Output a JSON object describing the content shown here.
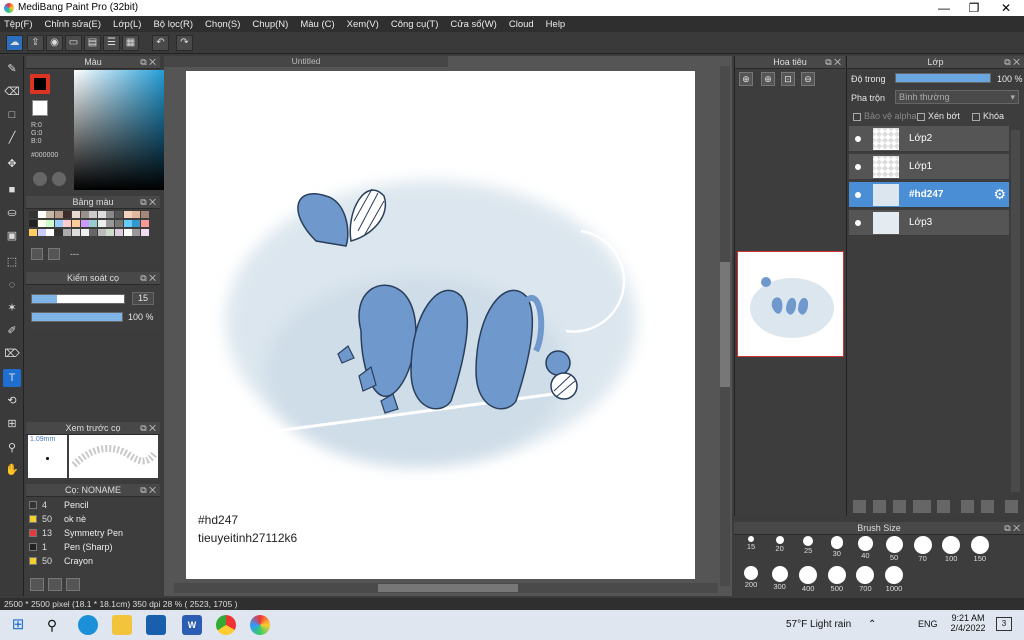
{
  "window": {
    "title": "MediBang Paint Pro (32bit)",
    "minimize": "—",
    "maximize": "❐",
    "close": "✕"
  },
  "menu": [
    "Tệp(F)",
    "Chỉnh sửa(E)",
    "Lớp(L)",
    "Bộ lọc(R)",
    "Chọn(S)",
    "Chụp(N)",
    "Màu (C)",
    "Xem(V)",
    "Công cụ(T)",
    "Cửa sổ(W)",
    "Cloud",
    "Help"
  ],
  "color_panel": {
    "title": "Màu",
    "r": "R:0",
    "g": "G:0",
    "b": "B:0",
    "hex": "#000000"
  },
  "swatch_panel": {
    "title": "Bảng màu",
    "menu": "---"
  },
  "control_panel": {
    "title": "Kiểm soát cọ",
    "size_value": "15",
    "opacity_value": "100 %",
    "size_fraction": 0.27,
    "opacity_fraction": 1.0
  },
  "preview_panel": {
    "title": "Xem trước cọ",
    "size_label": "1.09mm"
  },
  "brush_list": {
    "title": "Cọ: NONAME",
    "items": [
      {
        "size": "4",
        "name": "Pencil",
        "color": "#333333"
      },
      {
        "size": "50",
        "name": "ok nè",
        "color": "#f3d02a"
      },
      {
        "size": "13",
        "name": "Symmetry Pen",
        "color": "#e23b3b"
      },
      {
        "size": "1",
        "name": "Pen (Sharp)",
        "color": "#222222"
      },
      {
        "size": "50",
        "name": "Crayon",
        "color": "#f3d02a"
      }
    ]
  },
  "document": {
    "tab": "Untitled",
    "caption_line1": "#hd247",
    "caption_line2": "tieuyeitinh27112k6"
  },
  "navigator": {
    "title": "Hoa tiêu"
  },
  "layer_panel": {
    "title": "Lớp",
    "opacity_label": "Độ trong",
    "opacity_value": "100 %",
    "opacity_fraction": 1.0,
    "blend_label": "Pha trộn",
    "blend_value": "Bình thường",
    "protect_alpha": "Bảo vệ alpha",
    "clipping": "Xén bớt",
    "lock": "Khóa",
    "layers": [
      {
        "name": "Lớp2",
        "selected": false
      },
      {
        "name": "Lớp1",
        "selected": false
      },
      {
        "name": "#hd247",
        "selected": true
      },
      {
        "name": "Lớp3",
        "selected": false
      }
    ]
  },
  "brush_size": {
    "title": "Brush Size",
    "row1": [
      "15",
      "20",
      "25",
      "30",
      "40",
      "50",
      "70",
      "100",
      "150"
    ],
    "row2": [
      "200",
      "300",
      "400",
      "500",
      "700",
      "1000"
    ]
  },
  "status": "2500 * 2500 pixel  (18.1 * 18.1cm)  350 dpi  28 %  ( 2523, 1705 )",
  "taskbar": {
    "weather": "57°F  Light rain",
    "lang": "ENG",
    "time": "9:21 AM",
    "date": "2/4/2022",
    "notif": "3"
  },
  "colors": {
    "accent": "#4a8ed6",
    "art": "#6f98cc",
    "primary": "#000000"
  }
}
